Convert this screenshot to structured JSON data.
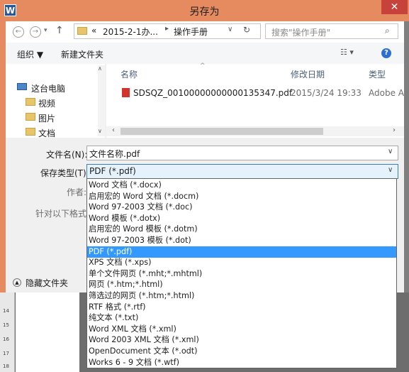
{
  "window": {
    "title": "另存为",
    "app_icon": "W"
  },
  "nav": {
    "path": [
      "«",
      "2015-2-1办...",
      "操作手册"
    ],
    "search_placeholder": "搜索\"操作手册\""
  },
  "toolbar": {
    "organize": "组织 ▼",
    "new_folder": "新建文件夹"
  },
  "sidebar": {
    "items": [
      {
        "label": "这台电脑",
        "icon": "computer-icon"
      },
      {
        "label": "视频",
        "icon": "video-folder-icon"
      },
      {
        "label": "图片",
        "icon": "picture-folder-icon"
      },
      {
        "label": "文档",
        "icon": "document-folder-icon"
      }
    ]
  },
  "columns": {
    "name": "名称",
    "date": "修改日期",
    "type": "类型"
  },
  "files": [
    {
      "name": "SDSQZ_00100000000000135347.pdf",
      "date": "2015/3/24 19:33",
      "type": "Adobe A"
    }
  ],
  "form": {
    "filename_label": "文件名(N):",
    "filename_value": "文件名称.pdf",
    "filetype_label": "保存类型(T):",
    "filetype_value": "PDF (*.pdf)",
    "author_label": "作者:",
    "format_label": "针对以下格式优",
    "hide_folders": "隐藏文件夹"
  },
  "filetypes": [
    "Word 文档 (*.docx)",
    "启用宏的 Word 文档 (*.docm)",
    "Word 97-2003 文档 (*.doc)",
    "Word 模板 (*.dotx)",
    "启用宏的 Word 模板 (*.dotm)",
    "Word 97-2003 模板 (*.dot)",
    "PDF (*.pdf)",
    "XPS 文档 (*.xps)",
    "单个文件网页 (*.mht;*.mhtml)",
    "网页 (*.htm;*.html)",
    "筛选过的网页 (*.htm;*.html)",
    "RTF 格式 (*.rtf)",
    "纯文本 (*.txt)",
    "Word XML 文档 (*.xml)",
    "Word 2003 XML 文档 (*.xml)",
    "OpenDocument 文本 (*.odt)",
    "Works 6 - 9 文档 (*.wtf)"
  ],
  "selected_filetype_index": 6,
  "ruler_marks": [
    "14",
    "15",
    "16",
    "17",
    "18"
  ],
  "colors": {
    "title_bar": "#e58b5f",
    "close": "#c7423b",
    "selection": "#3399ff",
    "pdf_icon": "#d0342c"
  }
}
